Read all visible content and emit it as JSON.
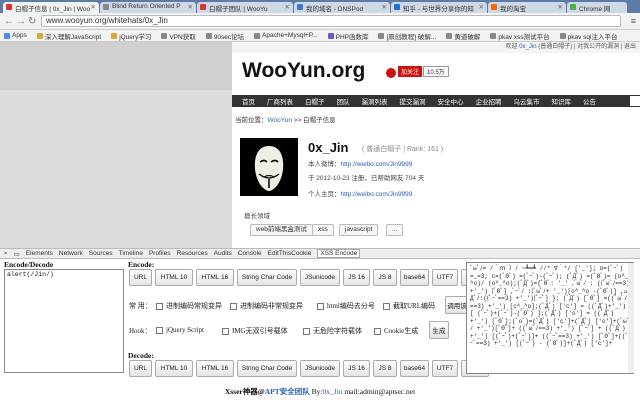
{
  "browser": {
    "tabs": [
      {
        "label": "白帽子信息 | 0x_Jin | Woo",
        "active": true
      },
      {
        "label": "Blind Return Oriented P",
        "active": false
      },
      {
        "label": "白帽子团队 | WooYu",
        "active": false
      },
      {
        "label": "我的域名 - DNSPod",
        "active": false
      },
      {
        "label": "知乎 - 与世界分享你的知",
        "active": false
      },
      {
        "label": "我的淘宝",
        "active": false
      },
      {
        "label": "Chrome 网",
        "active": false
      }
    ],
    "url": "www.wooyun.org/whitehats/0x_Jin",
    "bookmarks": [
      "Apps",
      "深入理解JavaScript",
      "jQuery学习",
      "VPN获取",
      "90sec论坛",
      "Apache+Mysql+P...",
      "PHP函数库",
      "[原创教程] 破解...",
      "黄道破解",
      "pkav xss测试平台",
      "pkav sql注入平台"
    ]
  },
  "site": {
    "toplinks_user": "0x_Jin",
    "toplinks_prefix": "欢迎 ",
    "toplinks_rest": "(普通白帽子) | 对我公开的漏洞 | 退出",
    "logo": "WooYun",
    "logo_suffix": ".org",
    "fan_label": "加关注",
    "fan_count": "10.5万",
    "nav": [
      "首页",
      "厂商列表",
      "白帽子",
      "团队",
      "漏洞列表",
      "提交漏洞",
      "安全中心",
      "企业招聘",
      "乌云集市",
      "知识库",
      "公告"
    ],
    "breadcrumb_prefix": "当前位置：",
    "breadcrumb_home": "WooYun",
    "breadcrumb_rest": " >> 白帽子信息"
  },
  "profile": {
    "name": "0x_Jin",
    "rank": "( 普通白帽子 | Rank: 161 )",
    "weibo_label": "本人微博：",
    "weibo_url": "http://weibo.com/Jin9999",
    "joined": "于 2012-10-23 注册，已帮助网友 704 天",
    "home_label": "个人主页：",
    "home_url": "http://weibo.com/Jin9999",
    "skills_header": "擅长领域",
    "skills": [
      "web前端黑盒测试",
      "xss",
      "javascript",
      "..."
    ]
  },
  "devtools": {
    "tabs": [
      "Elements",
      "Network",
      "Sources",
      "Timeline",
      "Profiles",
      "Resources",
      "Audits",
      "Console",
      "EditThisCookie",
      "XSS Encode"
    ]
  },
  "encoder": {
    "title": "Encode/Decode",
    "input_value": "alert(/Jin/)",
    "encode_label": "Encode:",
    "decode_label": "Decode:",
    "encode_buttons": [
      "URL",
      "HTML 10",
      "HTML 16",
      "String Char Code",
      "JSunicode",
      "JS 16",
      "JS 8",
      "base64",
      "UTF7",
      "utf-8jp"
    ],
    "decode_buttons": [
      "URL",
      "HTML 10",
      "HTML 16",
      "String Char Code",
      "JSunicode",
      "JS 16",
      "JS 8",
      "base64",
      "UTF7",
      "utf-8jp"
    ],
    "common_label": "常 用：",
    "common_opts": [
      "进制编码常规变异",
      "进制编码非常规变异",
      "html编码去分号",
      "截取URL编码"
    ],
    "common_btn": "调用该",
    "hook_label": "Hook：",
    "hook_opts": [
      "jQuery Script",
      "IMG无双引号载体",
      "无危险字符载体",
      "Cookie生成"
    ],
    "hook_btn": "生成",
    "output": "ﾟωﾟﾉ= /｀ｍ´）ﾉ ~┻━┻   //*´∇｀*/ ['_']; o=(ﾟｰﾟ)  =_=3; c=(ﾟΘﾟ) =(ﾟｰﾟ)-(ﾟｰﾟ); (ﾟДﾟ) =(ﾟΘﾟ)= (o^_^o)/ (o^_^o);(ﾟДﾟ)={ﾟΘﾟ: '_' ,ﾟωﾟﾉ : ((ﾟωﾟﾉ==3) +'_') [ﾟΘﾟ] ,ﾟｰﾟﾉ :(ﾟωﾟﾉ+ '_')[o^_^o -(ﾟΘﾟ)] ,ﾟДﾟﾉ:((ﾟｰﾟ==3) +'_')[ﾟｰﾟ] }; (ﾟДﾟ) [ﾟΘﾟ] =((ﾟωﾟﾉ==3) +'_') [c^_^o];(ﾟДﾟ) ['c'] = ((ﾟДﾟ)+'_') [ (ﾟｰﾟ)+(ﾟｰﾟ)-(ﾟΘﾟ) ];(ﾟДﾟ) ['o'] = ((ﾟДﾟ)+'_') [ﾟΘﾟ];(ﾟoﾟ)=(ﾟДﾟ) ['c']+(ﾟДﾟ) ['o']+(ﾟωﾟﾉ +'_')[ﾟΘﾟ]+ ((ﾟωﾟﾉ==3) +'_') [ﾟｰﾟ] + ((ﾟДﾟ) +'_') [(ﾟｰﾟ)+(ﾟｰﾟ)]+ ((ﾟｰﾟ==3) +'_') [ﾟΘﾟ]+((ﾟｰﾟ==3) +'_') [(ﾟｰﾟ) - (ﾟΘﾟ)]+(ﾟДﾟ) ['c']+",
    "footer_prefix": "Xsser神器@",
    "footer_team": "APT安全团队",
    "footer_by": " By:",
    "footer_author": "0x_Jin",
    "footer_mail": " mail:admin@aptsec.net"
  }
}
